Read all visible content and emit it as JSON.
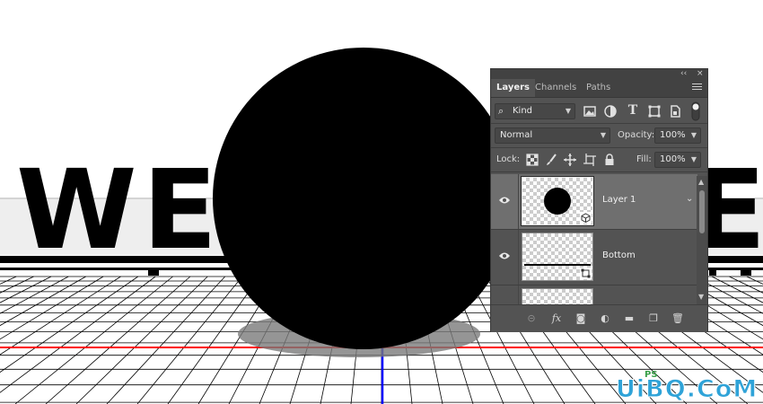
{
  "canvas": {
    "headline": "WE",
    "headline_tail": "E",
    "colors": {
      "background": "#ffffff",
      "letters": "#000000",
      "grid_lines": "#000000",
      "guide_red": "#ff0000",
      "guide_blue": "#0000ff",
      "sphere": "#000000",
      "shadow": "#7a7a7a"
    }
  },
  "layers_panel": {
    "topbar": {
      "collapse_glyph": "‹‹",
      "close_glyph": "×"
    },
    "tabs": [
      {
        "label": "Layers",
        "active": true
      },
      {
        "label": "Channels",
        "active": false
      },
      {
        "label": "Paths",
        "active": false
      }
    ],
    "filter": {
      "search_glyph": "⌕",
      "kind_label": "Kind",
      "filter_icons": [
        "image-filter-icon",
        "adjustment-filter-icon",
        "type-filter-icon",
        "shape-filter-icon",
        "smart-object-filter-icon"
      ],
      "type_glyph": "T"
    },
    "blend_mode": "Normal",
    "opacity_label": "Opacity:",
    "opacity_value": "100%",
    "lock_label": "Lock:",
    "lock_icons": [
      "lock-transparent-pixels-icon",
      "lock-image-pixels-icon",
      "lock-position-icon",
      "lock-artboard-icon",
      "lock-all-icon"
    ],
    "fill_label": "Fill:",
    "fill_value": "100%",
    "layers": [
      {
        "name": "Layer 1",
        "selected": true,
        "visible": true,
        "smart_object": true
      },
      {
        "name": "Bottom",
        "selected": false,
        "visible": true,
        "smart_object": true
      }
    ],
    "footer_buttons": [
      {
        "name": "link-layers-icon",
        "glyph": "⊝"
      },
      {
        "name": "fx-icon",
        "glyph": "fx"
      },
      {
        "name": "add-mask-icon",
        "glyph": "◙"
      },
      {
        "name": "adjustment-layer-icon",
        "glyph": "◐"
      },
      {
        "name": "new-group-icon",
        "glyph": "▬"
      },
      {
        "name": "new-layer-icon",
        "glyph": "❐"
      },
      {
        "name": "delete-layer-icon",
        "glyph": "🗑"
      }
    ],
    "accent": "#535353"
  },
  "watermark": {
    "brand": "UiBQ.CoM",
    "top_text": "PS"
  }
}
